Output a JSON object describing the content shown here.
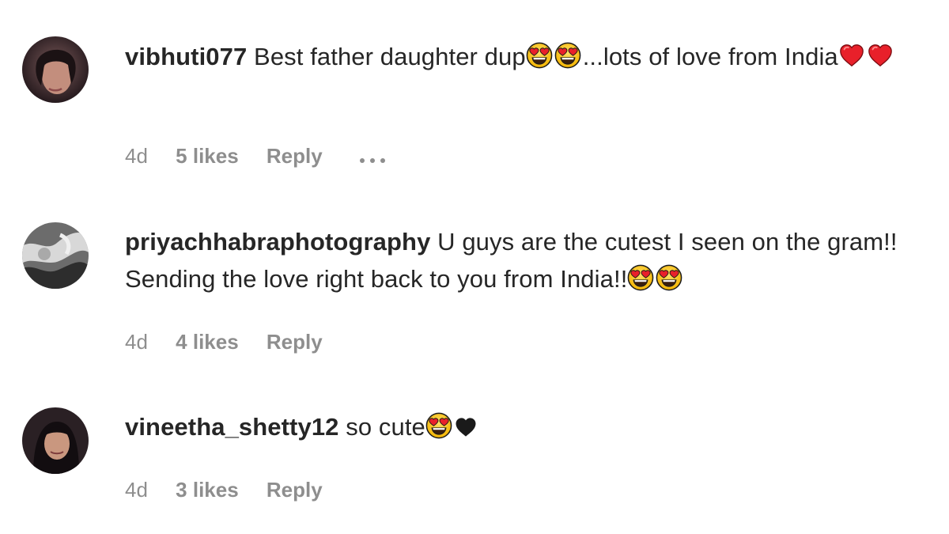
{
  "comments": [
    {
      "username": "vibhuti077",
      "text_parts": [
        "Best father daughter dup",
        "...lots of love from India"
      ],
      "emojis": [
        "heart-eyes-emoji",
        "heart-eyes-emoji",
        "red-heart-emoji",
        "red-heart-emoji"
      ],
      "time": "4d",
      "likes": "5 likes",
      "reply": "Reply",
      "has_more": true
    },
    {
      "username": "priyachhabraphotography",
      "text_parts": [
        "U guys are the cutest I seen on the gram!! Sending the love right back to you from India!!"
      ],
      "emojis": [
        "heart-eyes-emoji",
        "heart-eyes-emoji"
      ],
      "time": "4d",
      "likes": "4 likes",
      "reply": "Reply",
      "has_more": false
    },
    {
      "username": "vineetha_shetty12",
      "text_parts": [
        "so cute"
      ],
      "emojis": [
        "heart-eyes-emoji",
        "black-heart-emoji"
      ],
      "time": "4d",
      "likes": "3 likes",
      "reply": "Reply",
      "has_more": false
    }
  ],
  "colors": {
    "text": "#262626",
    "meta": "#8e8e8e",
    "background": "#ffffff"
  }
}
